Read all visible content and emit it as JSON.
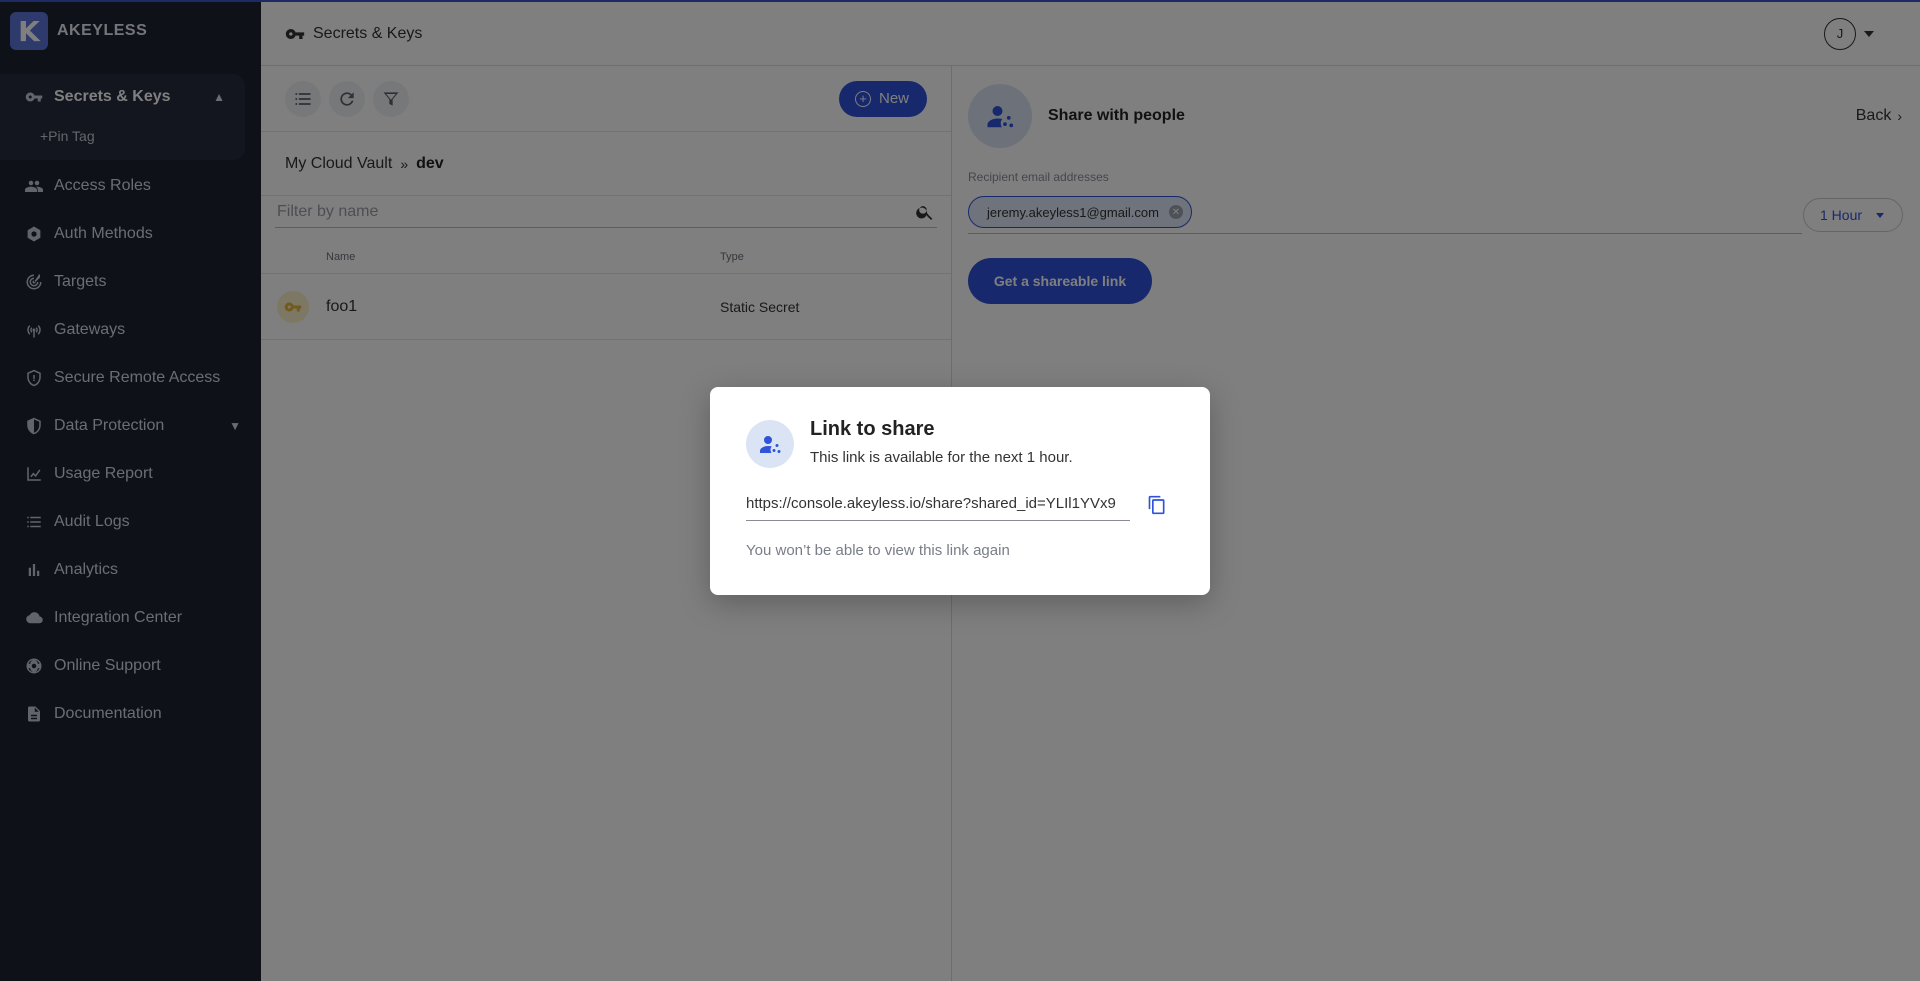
{
  "brand": {
    "logo_letter": "K",
    "name": "AKEYLESS"
  },
  "sidebar": {
    "active": {
      "label": "Secrets & Keys",
      "icon": "key-icon"
    },
    "pin_tag": "+Pin Tag",
    "items": [
      {
        "label": "Access Roles",
        "icon": "people-icon"
      },
      {
        "label": "Auth Methods",
        "icon": "gear-badge-icon"
      },
      {
        "label": "Targets",
        "icon": "target-icon"
      },
      {
        "label": "Gateways",
        "icon": "antenna-icon"
      },
      {
        "label": "Secure Remote Access",
        "icon": "shield-lock-icon"
      },
      {
        "label": "Data Protection",
        "icon": "shield-icon"
      },
      {
        "label": "Usage Report",
        "icon": "chart-line-icon"
      },
      {
        "label": "Audit Logs",
        "icon": "list-icon"
      },
      {
        "label": "Analytics",
        "icon": "bar-chart-icon"
      },
      {
        "label": "Integration Center",
        "icon": "cloud-icon"
      },
      {
        "label": "Online Support",
        "icon": "support-icon"
      },
      {
        "label": "Documentation",
        "icon": "document-icon"
      }
    ]
  },
  "header": {
    "title": "Secrets & Keys",
    "avatar_initial": "J"
  },
  "list_panel": {
    "new_label": "New",
    "breadcrumb": {
      "root": "My Cloud Vault",
      "separator": "»",
      "current": "dev"
    },
    "filter_placeholder": "Filter by name",
    "columns": {
      "name": "Name",
      "type": "Type"
    },
    "rows": [
      {
        "name": "foo1",
        "type": "Static Secret"
      }
    ]
  },
  "share_panel": {
    "title": "Share with people",
    "back_label": "Back",
    "recipients_label": "Recipient email addresses",
    "recipient_chip": "jeremy.akeyless1@gmail.com",
    "duration": "1 Hour",
    "get_link_label": "Get a shareable link"
  },
  "modal": {
    "title": "Link to share",
    "subtitle": "This link is available for the next 1 hour.",
    "link": "https://console.akeyless.io/share?shared_id=YLIl1YVx9",
    "note": "You won’t be able to view this link again"
  },
  "colors": {
    "accent": "#2f53d9",
    "sidebar_bg": "#1f2233",
    "overlay": "rgba(0,0,0,0.5)"
  }
}
